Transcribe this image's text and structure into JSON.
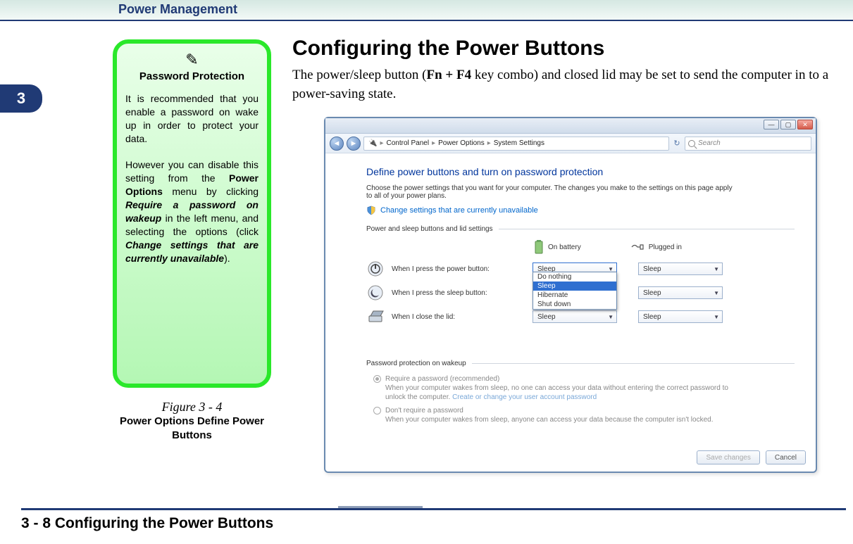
{
  "header": {
    "title": "Power Management"
  },
  "chapter": {
    "number": "3"
  },
  "note": {
    "icon": "✎",
    "title": "Password Protection",
    "para1": "It is recommended that you enable a password on wake up in order to protect your data.",
    "para2_pre": "However you can disable this setting from the ",
    "para2_b1": "Power Options",
    "para2_mid1": " menu by clicking ",
    "para2_bi1": "Require a password on wakeup",
    "para2_mid2": " in the left menu, and selecting the options (click ",
    "para2_bi2": "Change settings that are currently unavailable",
    "para2_end": ")."
  },
  "figure": {
    "number": "Figure 3 - 4",
    "title": "Power Options Define Power Buttons"
  },
  "main": {
    "h1": "Configuring the Power Buttons",
    "lead_pre": "The power/sleep button (",
    "lead_b": "Fn + F4",
    "lead_post": " key combo) and closed lid may be set to send the computer in to a power-saving state."
  },
  "window": {
    "breadcrumb": [
      "Control Panel",
      "Power Options",
      "System Settings"
    ],
    "search_placeholder": "Search",
    "heading": "Define power buttons and turn on password protection",
    "desc": "Choose the power settings that you want for your computer. The changes you make to the settings on this page apply to all of your power plans.",
    "change_link": "Change settings that are currently unavailable",
    "section1": "Power and sleep buttons and lid settings",
    "col_battery": "On battery",
    "col_plugged": "Plugged in",
    "rows": [
      {
        "label": "When I press the power button:",
        "battery": "Sleep",
        "plugged": "Sleep"
      },
      {
        "label": "When I press the sleep button:",
        "battery": "Sleep",
        "plugged": "Sleep"
      },
      {
        "label": "When I close the lid:",
        "battery": "Sleep",
        "plugged": "Sleep"
      }
    ],
    "dropdown_options": [
      "Do nothing",
      "Sleep",
      "Hibernate",
      "Shut down"
    ],
    "dropdown_selected": "Sleep",
    "section2": "Password protection on wakeup",
    "radio1_title": "Require a password (recommended)",
    "radio1_body_pre": "When your computer wakes from sleep, no one can access your data without entering the correct password to unlock the computer. ",
    "radio1_link": "Create or change your user account password",
    "radio2_title": "Don't require a password",
    "radio2_body": "When your computer wakes from sleep, anyone can access your data because the computer isn't locked.",
    "save_btn": "Save changes",
    "cancel_btn": "Cancel"
  },
  "footer": {
    "text": "3  -  8  Configuring the Power Buttons"
  }
}
